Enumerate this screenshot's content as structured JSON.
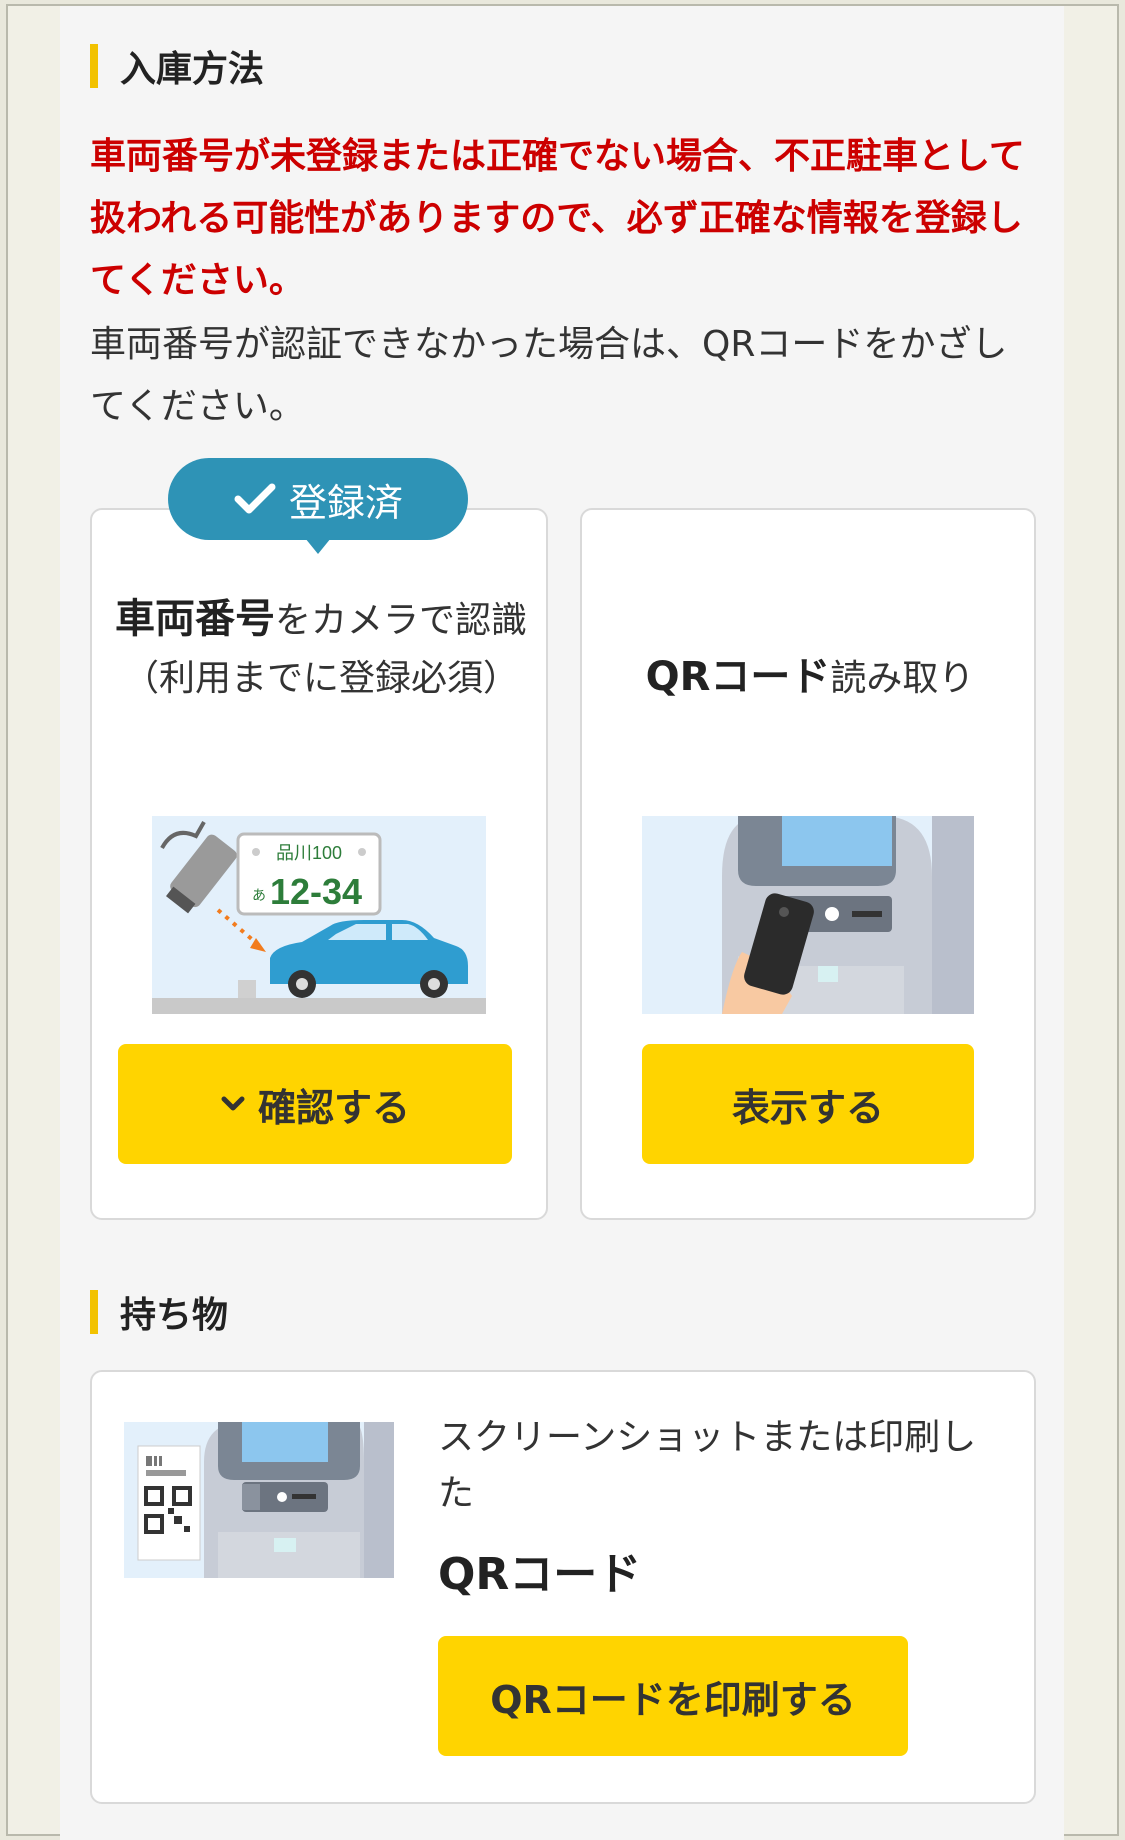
{
  "section1": {
    "title": "入庫方法"
  },
  "warning": "車両番号が未登録または正確でない場合、不正駐車として扱われる可能性がありますので、必ず正確な情報を登録してください。",
  "info": "車両番号が認証できなかった場合は、QRコードをかざしてください。",
  "card_plate": {
    "badge": "登録済",
    "title_bold": "車両番号",
    "title_rest": "をカメラで認識",
    "note": "（利用までに登録必須）",
    "plate_area": "品川100",
    "plate_kana": "あ",
    "plate_number": "12-34",
    "button": "確認する"
  },
  "card_qr": {
    "title_bold": "QRコード",
    "title_rest": "読み取り",
    "button": "表示する"
  },
  "section2": {
    "title": "持ち物"
  },
  "items_card": {
    "desc": "スクリーンショットまたは印刷した",
    "item": "QRコード",
    "button": "QRコードを印刷する"
  },
  "colors": {
    "accent": "#ffd400",
    "warning": "#cc0000",
    "badge": "#2e93b6"
  },
  "icons": [
    "check-icon",
    "chevron-down-icon"
  ]
}
